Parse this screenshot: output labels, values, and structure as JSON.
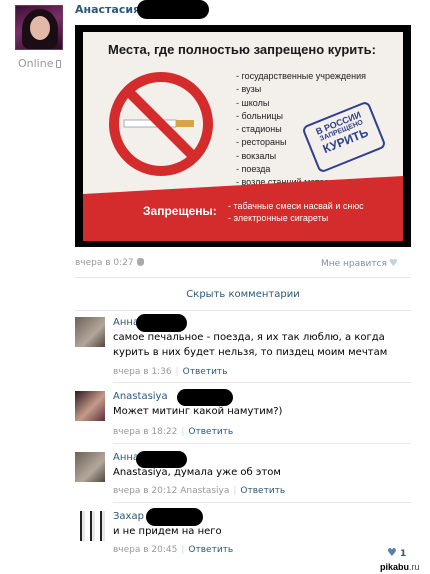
{
  "post": {
    "author": "Анастасия",
    "online_status": "Online",
    "time": "вчера в 0:27",
    "like_label": "Мне нравится"
  },
  "image": {
    "title": "Места, где полностью запрещено курить:",
    "places": [
      "государственные учреждения",
      "вузы",
      "школы",
      "больницы",
      "стадионы",
      "рестораны",
      "вокзалы",
      "поезда",
      "возле станций метро"
    ],
    "stamp": [
      "В РОССИИ",
      "ЗАПРЕЩЕНО",
      "КУРИТЬ"
    ],
    "banned_label": "Запрещены:",
    "banned_items": [
      "табачные смеси насвай и снюс",
      "электронные сигареты"
    ]
  },
  "hide_comments": "Скрыть комментарии",
  "comments": [
    {
      "author": "Анна",
      "text": "самое печальное - поезда, я их так люблю, а когда курить в них будет нельзя, то пиздец моим мечтам",
      "time": "вчера в 1:36",
      "mention": "",
      "reply": "Ответить"
    },
    {
      "author": "Anastasiya",
      "text": "Может митинг какой намутим?)",
      "time": "вчера в 18:22",
      "mention": "",
      "reply": "Ответить"
    },
    {
      "author": "Анна",
      "text": "Anastasiya, думала уже об этом",
      "time": "вчера в 20:12",
      "mention": "Anastasiya",
      "reply": "Ответить"
    },
    {
      "author": "Захар",
      "text": "и не придем на него",
      "time": "вчера в 20:45",
      "mention": "",
      "reply": "Ответить",
      "likes": "1"
    }
  ],
  "watermark": {
    "bold": "pikabu",
    "rest": ".ru"
  },
  "colors": {
    "link": "#2b587a",
    "meta": "#999999",
    "ban_red": "#d42c2c",
    "stamp_blue": "#2f3f8f"
  }
}
